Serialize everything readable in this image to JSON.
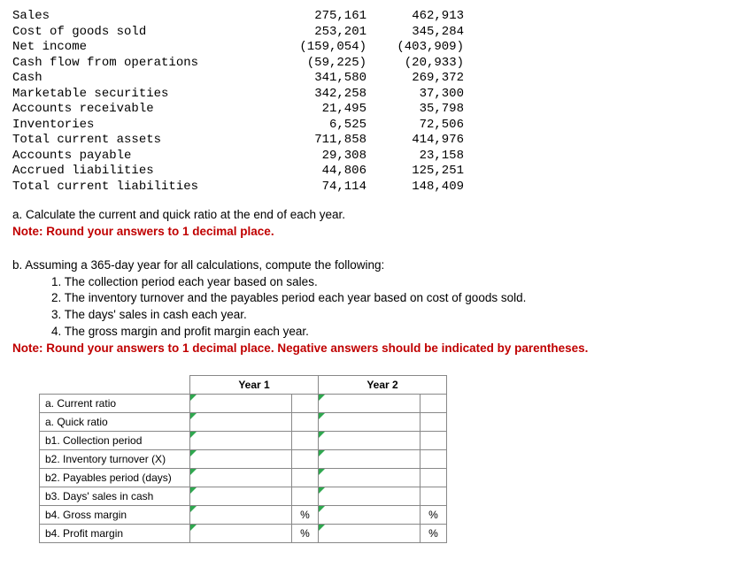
{
  "financial_rows": [
    {
      "label": "Sales",
      "c1": "275,161",
      "c2": "462,913"
    },
    {
      "label": "Cost of goods sold",
      "c1": "253,201",
      "c2": "345,284"
    },
    {
      "label": "Net income",
      "c1": "(159,054)",
      "c2": "(403,909)"
    },
    {
      "label": "Cash flow from operations",
      "c1": "(59,225)",
      "c2": "(20,933)"
    },
    {
      "label": "Cash",
      "c1": "341,580",
      "c2": "269,372"
    },
    {
      "label": "Marketable securities",
      "c1": "342,258",
      "c2": "37,300"
    },
    {
      "label": "Accounts receivable",
      "c1": "21,495",
      "c2": "35,798"
    },
    {
      "label": "Inventories",
      "c1": "6,525",
      "c2": "72,506"
    },
    {
      "label": "Total current assets",
      "c1": "711,858",
      "c2": "414,976"
    },
    {
      "label": "Accounts payable",
      "c1": "29,308",
      "c2": "23,158"
    },
    {
      "label": "Accrued liabilities",
      "c1": "44,806",
      "c2": "125,251"
    },
    {
      "label": "Total current liabilities",
      "c1": "74,114",
      "c2": "148,409"
    }
  ],
  "q_a_line1": "a. Calculate the current and quick ratio at the end of each year.",
  "q_a_note": "Note: Round your answers to 1 decimal place.",
  "q_b_intro": "b. Assuming a 365-day year for all calculations, compute the following:",
  "q_b_1": "1. The collection period each year based on sales.",
  "q_b_2": "2. The inventory turnover and the payables period each year based on cost of goods sold.",
  "q_b_3": "3. The days' sales in cash each year.",
  "q_b_4": "4. The gross margin and profit margin each year.",
  "q_b_note": "Note: Round your answers to 1 decimal place. Negative answers should be indicated by parentheses.",
  "table": {
    "headers": [
      "Year 1",
      "Year 2"
    ],
    "rows": [
      {
        "label": "a. Current ratio",
        "unit1": "",
        "unit2": ""
      },
      {
        "label": "a. Quick ratio",
        "unit1": "",
        "unit2": ""
      },
      {
        "label": "b1. Collection period",
        "unit1": "",
        "unit2": ""
      },
      {
        "label": "b2. Inventory turnover (X)",
        "unit1": "",
        "unit2": ""
      },
      {
        "label": "b2. Payables period (days)",
        "unit1": "",
        "unit2": ""
      },
      {
        "label": "b3. Days' sales in cash",
        "unit1": "",
        "unit2": ""
      },
      {
        "label": "b4. Gross margin",
        "unit1": "%",
        "unit2": "%"
      },
      {
        "label": "b4. Profit margin",
        "unit1": "%",
        "unit2": "%"
      }
    ]
  }
}
